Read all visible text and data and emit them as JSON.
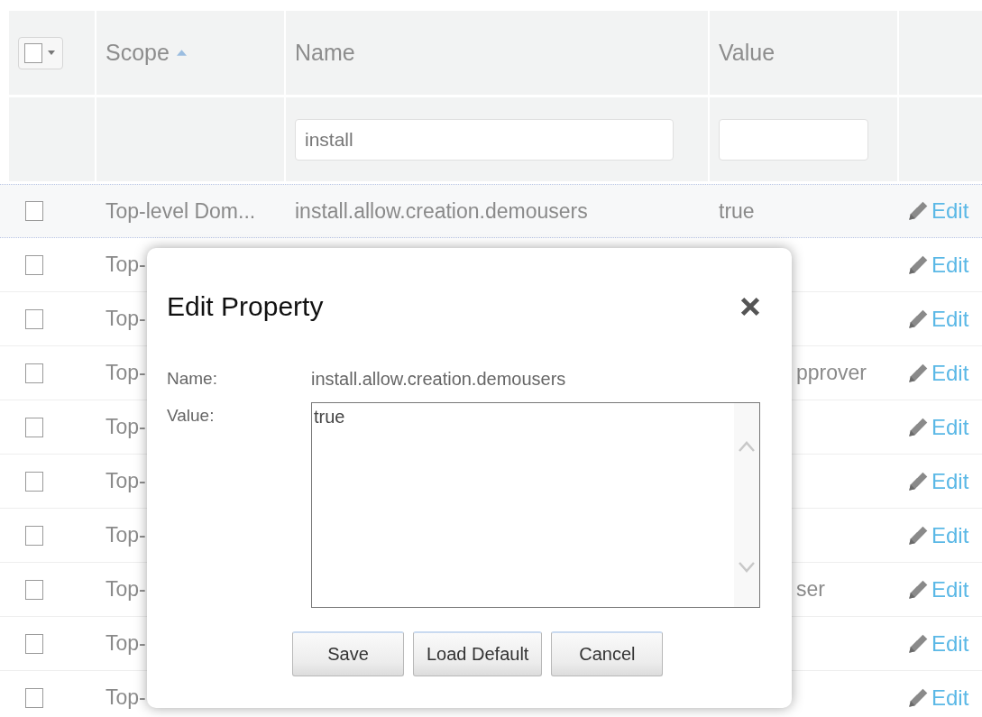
{
  "table": {
    "select_all": {
      "checked": false
    },
    "columns": [
      {
        "label": "Scope",
        "sorted": true
      },
      {
        "label": "Name",
        "sorted": false
      },
      {
        "label": "Value",
        "sorted": false
      }
    ],
    "name_filter": {
      "value": "install"
    },
    "rows": [
      {
        "checked": false,
        "highlighted": true,
        "scope": "Top-level Dom...",
        "name": "install.allow.creation.demousers",
        "value": "true",
        "action": "Edit"
      },
      {
        "checked": false,
        "highlighted": false,
        "scope": "Top-",
        "action": "Edit"
      },
      {
        "checked": false,
        "highlighted": false,
        "scope": "Top-",
        "action": "Edit"
      },
      {
        "checked": false,
        "highlighted": false,
        "scope": "Top-",
        "value": "pprover",
        "action": "Edit"
      },
      {
        "checked": false,
        "highlighted": false,
        "scope": "Top-",
        "action": "Edit"
      },
      {
        "checked": false,
        "highlighted": false,
        "scope": "Top-",
        "action": "Edit"
      },
      {
        "checked": false,
        "highlighted": false,
        "scope": "Top-",
        "action": "Edit"
      },
      {
        "checked": false,
        "highlighted": false,
        "scope": "Top-",
        "value": "ser",
        "action": "Edit"
      },
      {
        "checked": false,
        "highlighted": false,
        "scope": "Top-",
        "action": "Edit"
      },
      {
        "checked": false,
        "highlighted": false,
        "scope": "Top-",
        "action": "Edit"
      }
    ]
  },
  "dialog": {
    "title": "Edit Property",
    "fields": [
      {
        "kind": "text",
        "label": "Name:",
        "value": "install.allow.creation.demousers"
      },
      {
        "kind": "textarea",
        "label": "Value:",
        "value": "true"
      }
    ],
    "buttons": [
      "Save",
      "Load Default",
      "Cancel"
    ]
  }
}
